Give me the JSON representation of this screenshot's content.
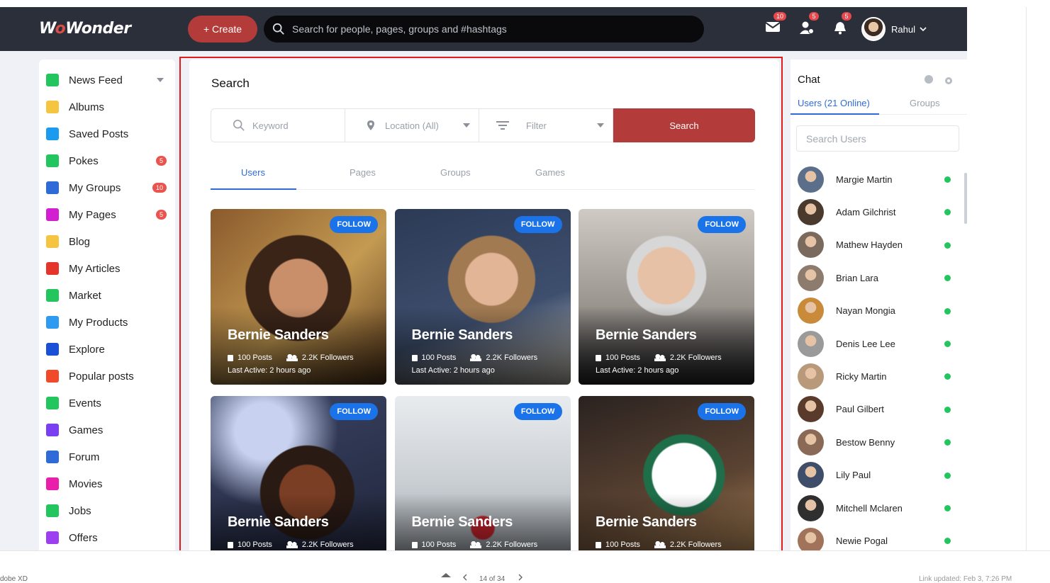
{
  "header": {
    "logo_text_a": "W",
    "logo_text_o": "o",
    "logo_text_b": "Wonder",
    "create_label": "+ Create",
    "search_placeholder": "Search for people, pages, groups and #hashtags",
    "messages_count": "10",
    "friend_requests_count": "5",
    "notifications_count": "5",
    "user_name": "Rahul"
  },
  "sidebar": {
    "items": [
      {
        "label": "News Feed",
        "icon": "home-icon",
        "color": "#22c55e",
        "badge": ""
      },
      {
        "label": "Albums",
        "icon": "albums-icon",
        "color": "#f5c542",
        "badge": ""
      },
      {
        "label": "Saved Posts",
        "icon": "bookmark-icon",
        "color": "#1a9bf0",
        "badge": ""
      },
      {
        "label": "Pokes",
        "icon": "poke-hand-icon",
        "color": "#22c55e",
        "badge": "5"
      },
      {
        "label": "My Groups",
        "icon": "groups-icon",
        "color": "#2f6bd8",
        "badge": "10"
      },
      {
        "label": "My Pages",
        "icon": "flag-icon",
        "color": "#d21fd2",
        "badge": "5"
      },
      {
        "label": "Blog",
        "icon": "blog-icon",
        "color": "#f5c542",
        "badge": ""
      },
      {
        "label": "My Articles",
        "icon": "articles-icon",
        "color": "#e5342a",
        "badge": ""
      },
      {
        "label": "Market",
        "icon": "market-icon",
        "color": "#22c55e",
        "badge": ""
      },
      {
        "label": "My Products",
        "icon": "products-icon",
        "color": "#2f9bf0",
        "badge": ""
      },
      {
        "label": "Explore",
        "icon": "compass-icon",
        "color": "#1a4fd8",
        "badge": ""
      },
      {
        "label": "Popular posts",
        "icon": "fire-icon",
        "color": "#f04a2a",
        "badge": ""
      },
      {
        "label": "Events",
        "icon": "calendar-icon",
        "color": "#22c55e",
        "badge": ""
      },
      {
        "label": "Games",
        "icon": "gamepad-icon",
        "color": "#7a3ff0",
        "badge": ""
      },
      {
        "label": "Forum",
        "icon": "forum-icon",
        "color": "#2f6bd8",
        "badge": ""
      },
      {
        "label": "Movies",
        "icon": "movie-icon",
        "color": "#e91eab",
        "badge": ""
      },
      {
        "label": "Jobs",
        "icon": "briefcase-icon",
        "color": "#22c55e",
        "badge": ""
      },
      {
        "label": "Offers",
        "icon": "offers-icon",
        "color": "#9b3ff0",
        "badge": ""
      }
    ]
  },
  "search_page": {
    "title": "Search",
    "keyword_placeholder": "Keyword",
    "location_label": "Location (All)",
    "filter_label": "Filter",
    "search_button": "Search",
    "tabs": [
      {
        "label": "Users",
        "active": true
      },
      {
        "label": "Pages",
        "active": false
      },
      {
        "label": "Groups",
        "active": false
      },
      {
        "label": "Games",
        "active": false
      }
    ],
    "results": [
      {
        "name": "Bernie Sanders",
        "posts": "100 Posts",
        "followers": "2.2K Followers",
        "last_active": "Last Active: 2 hours ago",
        "follow": "FOLLOW"
      },
      {
        "name": "Bernie Sanders",
        "posts": "100 Posts",
        "followers": "2.2K Followers",
        "last_active": "Last Active: 2 hours ago",
        "follow": "FOLLOW"
      },
      {
        "name": "Bernie Sanders",
        "posts": "100 Posts",
        "followers": "2.2K Followers",
        "last_active": "Last Active: 2 hours ago",
        "follow": "FOLLOW"
      },
      {
        "name": "Bernie Sanders",
        "posts": "100 Posts",
        "followers": "2.2K Followers",
        "last_active": "",
        "follow": "FOLLOW"
      },
      {
        "name": "Bernie Sanders",
        "posts": "100 Posts",
        "followers": "2.2K Followers",
        "last_active": "",
        "follow": "FOLLOW"
      },
      {
        "name": "Bernie Sanders",
        "posts": "100 Posts",
        "followers": "2.2K Followers",
        "last_active": "",
        "follow": "FOLLOW"
      }
    ]
  },
  "chat": {
    "title": "Chat",
    "tab_users": "Users (21 Online)",
    "tab_groups": "Groups",
    "search_placeholder": "Search Users",
    "users": [
      {
        "name": "Margie Martin",
        "online": true
      },
      {
        "name": "Adam Gilchrist",
        "online": true
      },
      {
        "name": "Mathew Hayden",
        "online": true
      },
      {
        "name": "Brian Lara",
        "online": true
      },
      {
        "name": "Nayan Mongia",
        "online": true
      },
      {
        "name": "Denis Lee Lee",
        "online": true
      },
      {
        "name": "Ricky Martin",
        "online": true
      },
      {
        "name": "Paul Gilbert",
        "online": true
      },
      {
        "name": "Bestow Benny",
        "online": true
      },
      {
        "name": "Lily Paul",
        "online": true
      },
      {
        "name": "Mitchell Mclaren",
        "online": true
      },
      {
        "name": "Newie Pogal",
        "online": true
      }
    ]
  },
  "viewer": {
    "left_text": "dobe XD",
    "page_indicator": "14 of 34",
    "right_text": "Link updated: Feb 3, 7:26 PM"
  },
  "colors": {
    "accent_red": "#b33b39",
    "accent_blue": "#2f6bd8",
    "online_green": "#22c55e",
    "topbar_bg": "#2b2f3a",
    "highlight_outline": "#e21b1b"
  }
}
